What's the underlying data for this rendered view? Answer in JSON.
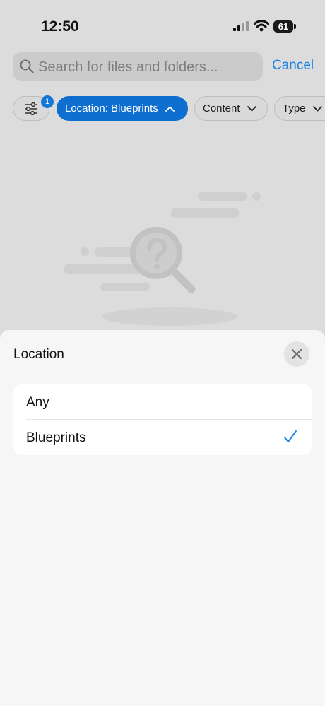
{
  "status_bar": {
    "time": "12:50",
    "battery": "61"
  },
  "search": {
    "placeholder": "Search for files and folders...",
    "cancel_label": "Cancel"
  },
  "filters": {
    "badge_count": "1",
    "location_chip": "Location: Blueprints",
    "content_chip": "Content",
    "type_chip": "Type"
  },
  "sheet": {
    "title": "Location",
    "options": [
      {
        "label": "Any",
        "selected": false
      },
      {
        "label": "Blueprints",
        "selected": true
      }
    ]
  },
  "colors": {
    "accent": "#0f6fd1",
    "link": "#1a84e6",
    "check": "#1a84e6"
  },
  "icons": {
    "search": "magnifier-icon",
    "filter": "sliders-icon",
    "chevron_up": "chevron-up-icon",
    "chevron_down": "chevron-down-icon",
    "close": "close-icon",
    "check": "checkmark-icon",
    "empty": "question-magnifier-illustration"
  }
}
